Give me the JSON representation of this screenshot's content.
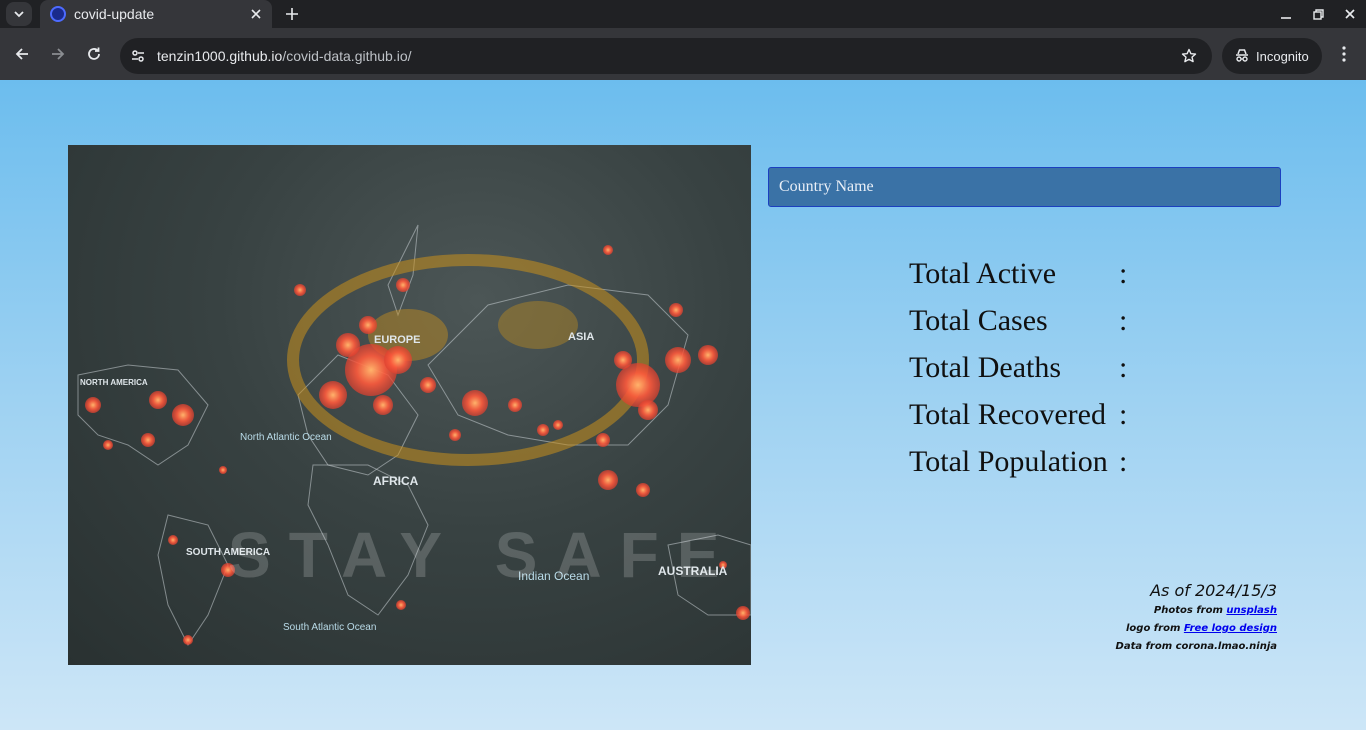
{
  "browser": {
    "tab_title": "covid-update",
    "url_host": "tenzin1000.github.io",
    "url_path": "/covid-data.github.io/",
    "incognito_label": "Incognito"
  },
  "page": {
    "search": {
      "placeholder": "Country Name",
      "value": ""
    },
    "stats": [
      {
        "label": "Total Active",
        "sep": ":",
        "value": ""
      },
      {
        "label": "Total Cases",
        "sep": ":",
        "value": ""
      },
      {
        "label": "Total Deaths",
        "sep": ":",
        "value": ""
      },
      {
        "label": "Total Recovered",
        "sep": ":",
        "value": ""
      },
      {
        "label": "Total Population",
        "sep": ":",
        "value": ""
      }
    ],
    "as_of": "As of 2024/15/3",
    "credits": {
      "photos_prefix": "Photos from",
      "photos_link": "unsplash",
      "logo_prefix": "logo from",
      "logo_link": "Free logo design",
      "data_text": "Data from corona.lmao.ninja"
    },
    "map_labels": {
      "europe": "EUROPE",
      "asia": "ASIA",
      "africa": "AFRICA",
      "north_america": "NORTH AMERICA",
      "south_america": "SOUTH AMERICA",
      "australia": "AUSTRALIA",
      "north_atlantic": "North Atlantic Ocean",
      "south_atlantic": "South Atlantic Ocean",
      "indian_ocean": "Indian Ocean",
      "stay_safe": "STAY SAFE"
    }
  }
}
